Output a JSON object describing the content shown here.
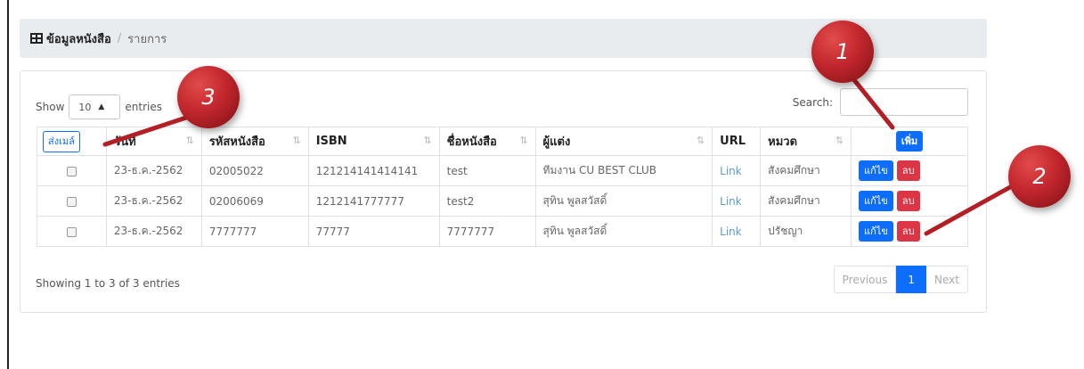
{
  "breadcrumb": {
    "current": "ข้อมูลหนังสือ",
    "separator": "/",
    "item": "รายการ"
  },
  "length_control": {
    "prefix": "Show",
    "value": "10",
    "suffix": "entries"
  },
  "search": {
    "label": "Search:",
    "value": ""
  },
  "table": {
    "send_mail_label": "ส่งเมล์",
    "add_label": "เพิ่ม",
    "columns": [
      "วันที่",
      "รหัสหนังสือ",
      "ISBN",
      "ชื่อหนังสือ",
      "ผู้แต่ง",
      "URL",
      "หมวด"
    ],
    "edit_label": "แก้ไข",
    "delete_label": "ลบ",
    "rows": [
      {
        "date": "23-ธ.ค.-2562",
        "code": "02005022",
        "isbn": "121214141414141",
        "title": "test",
        "author": "ทีมงาน CU BEST CLUB",
        "url": "Link",
        "category": "สังคมศึกษา"
      },
      {
        "date": "23-ธ.ค.-2562",
        "code": "02006069",
        "isbn": "1212141777777",
        "title": "test2",
        "author": "สุทิน พูลสวัสดิ์",
        "url": "Link",
        "category": "สังคมศึกษา"
      },
      {
        "date": "23-ธ.ค.-2562",
        "code": "7777777",
        "isbn": "77777",
        "title": "7777777",
        "author": "สุทิน พูลสวัสดิ์",
        "url": "Link",
        "category": "ปรัชญา"
      }
    ]
  },
  "info": "Showing 1 to 3 of 3 entries",
  "pagination": {
    "previous": "Previous",
    "current": "1",
    "next": "Next"
  },
  "markers": [
    "1",
    "2",
    "3"
  ]
}
